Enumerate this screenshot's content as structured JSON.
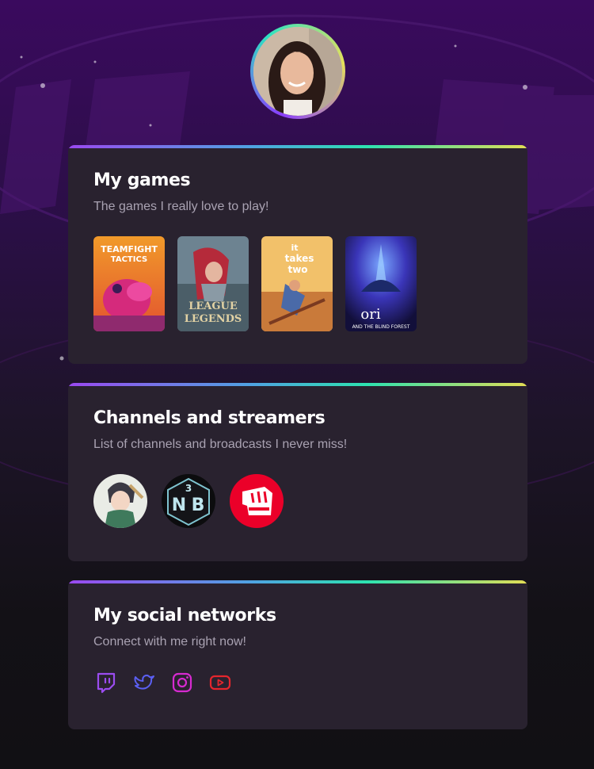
{
  "profile": {
    "avatar_alt": "profile photo"
  },
  "cards": {
    "games": {
      "title": "My games",
      "subtitle": "The games I really love to play!",
      "items": [
        {
          "name": "Teamfight Tactics",
          "icon": "teamfight-tactics-cover"
        },
        {
          "name": "League of Legends",
          "icon": "league-of-legends-cover"
        },
        {
          "name": "It Takes Two",
          "icon": "it-takes-two-cover"
        },
        {
          "name": "Ori and the Blind Forest",
          "icon": "ori-blind-forest-cover"
        }
      ]
    },
    "channels": {
      "title": "Channels and streamers",
      "subtitle": "List of channels and broadcasts I never miss!",
      "items": [
        {
          "icon": "anime-streamer-avatar"
        },
        {
          "icon": "nb-dice-channel-avatar"
        },
        {
          "icon": "riot-games-fist-avatar"
        }
      ]
    },
    "socials": {
      "title": "My social networks",
      "subtitle": "Connect with me right now!",
      "items": [
        {
          "icon": "twitch-icon",
          "color": "#9b4cf0"
        },
        {
          "icon": "twitter-icon",
          "color": "#5b5ff2"
        },
        {
          "icon": "instagram-icon",
          "color": "#d62ad0"
        },
        {
          "icon": "youtube-icon",
          "color": "#e5262d"
        }
      ]
    }
  }
}
